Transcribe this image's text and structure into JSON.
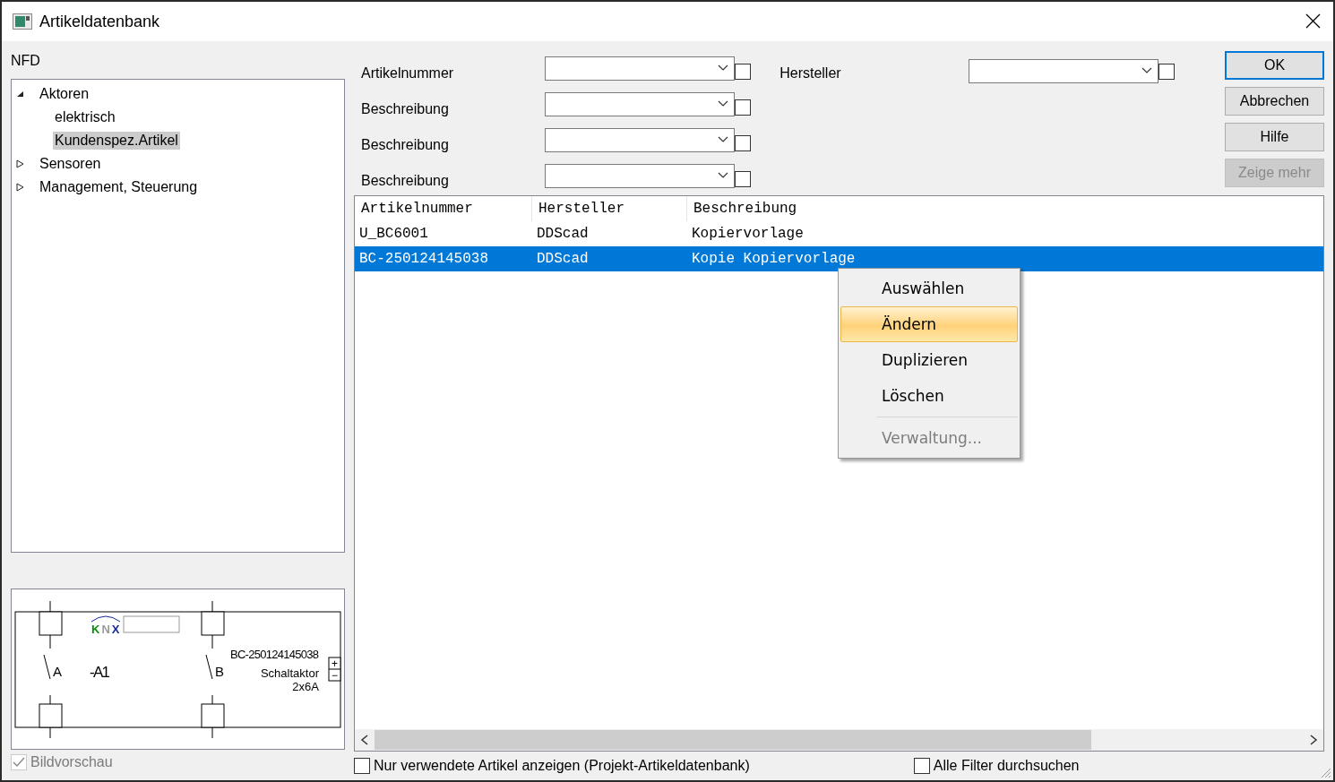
{
  "window": {
    "title": "Artikeldatenbank"
  },
  "tree": {
    "title": "NFD",
    "items": [
      {
        "label": "Aktoren",
        "expanded": true,
        "selected": false,
        "children": [
          {
            "label": "elektrisch",
            "selected": false
          },
          {
            "label": "Kundenspez.Artikel",
            "selected": true
          }
        ]
      },
      {
        "label": "Sensoren",
        "expanded": false,
        "selected": false
      },
      {
        "label": "Management, Steuerung",
        "expanded": false,
        "selected": false
      }
    ]
  },
  "preview": {
    "designation": "-A1",
    "contact_a": "A",
    "contact_b": "B",
    "article": "BC-250124145038",
    "type": "Schaltaktor",
    "rating": "2x6A",
    "logo": [
      {
        "text": "K",
        "color": "#128a12"
      },
      {
        "text": "N",
        "color": "#9a9a9a"
      },
      {
        "text": "X",
        "color": "#1a2a9a"
      }
    ],
    "plus": "+",
    "minus": "−"
  },
  "preview_toggle": {
    "label": "Bildvorschau",
    "checked": true,
    "disabled": true
  },
  "filters": [
    {
      "label": "Artikelnummer",
      "checked": false
    },
    {
      "label": "Beschreibung",
      "checked": false
    },
    {
      "label": "Beschreibung",
      "checked": false
    },
    {
      "label": "Beschreibung",
      "checked": false
    }
  ],
  "manufacturer_filter": {
    "label": "Hersteller",
    "checked": false
  },
  "buttons": [
    {
      "label": "OK",
      "kind": "default",
      "disabled": false
    },
    {
      "label": "Abbrechen",
      "kind": "normal",
      "disabled": false
    },
    {
      "label": "Hilfe",
      "kind": "normal",
      "disabled": false
    },
    {
      "label": "Zeige mehr",
      "kind": "normal",
      "disabled": true
    }
  ],
  "table": {
    "columns": [
      "Artikelnummer",
      "Hersteller",
      "Beschreibung"
    ],
    "rows": [
      {
        "cells": [
          "U_BC6001",
          "DDScad",
          "Kopiervorlage"
        ],
        "selected": false
      },
      {
        "cells": [
          "BC-250124145038",
          "DDScad",
          "Kopie Kopiervorlage"
        ],
        "selected": true
      }
    ]
  },
  "context_menu": {
    "items": [
      {
        "kind": "item",
        "label": "Auswählen",
        "highlighted": false,
        "disabled": false
      },
      {
        "kind": "item",
        "label": "Ändern",
        "highlighted": true,
        "disabled": false
      },
      {
        "kind": "item",
        "label": "Duplizieren",
        "highlighted": false,
        "disabled": false
      },
      {
        "kind": "item",
        "label": "Löschen",
        "highlighted": false,
        "disabled": false
      },
      {
        "kind": "separator"
      },
      {
        "kind": "item",
        "label": "Verwaltung...",
        "highlighted": false,
        "disabled": true
      }
    ]
  },
  "options": [
    {
      "label": "Nur verwendete Artikel anzeigen (Projekt-Artikeldatenbank)",
      "checked": false
    },
    {
      "label": "Alle Filter durchsuchen",
      "checked": false
    }
  ]
}
